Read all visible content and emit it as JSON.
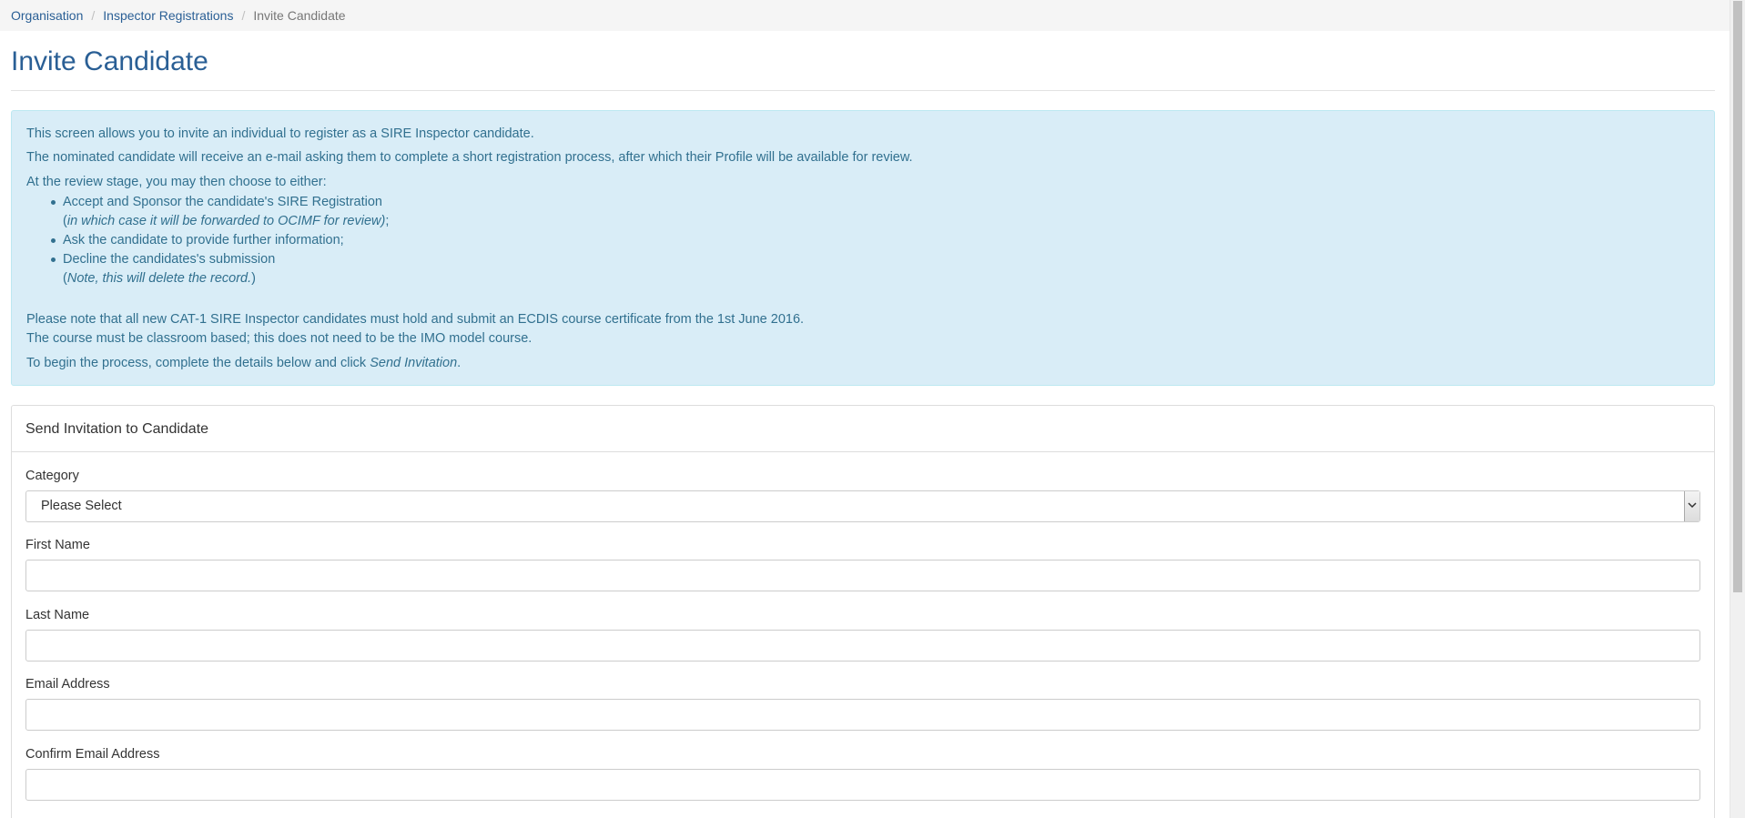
{
  "breadcrumb": {
    "items": [
      "Organisation",
      "Inspector Registrations"
    ],
    "separator": "/",
    "current": "Invite Candidate"
  },
  "page_title": "Invite Candidate",
  "info": {
    "line1": "This screen allows you to invite an individual to register as a SIRE Inspector candidate.",
    "line2": "The nominated candidate will receive an e-mail asking them to complete a short registration process, after which their Profile will be available for review.",
    "line3": "At the review stage, you may then choose to either:",
    "bullets": [
      {
        "text": "Accept and Sponsor the candidate's SIRE Registration",
        "note_open": "(",
        "note_italic": "in which case it will be forwarded to OCIMF for review)",
        "note_close": ";"
      },
      {
        "text": "Ask the candidate to provide further information;"
      },
      {
        "text": "Decline the candidates's submission",
        "note_open": "(",
        "note_italic": "Note, this will delete the record.",
        "note_close": ")"
      }
    ],
    "line4": "Please note that all new CAT-1 SIRE Inspector candidates must hold and submit an ECDIS course certificate from the 1st June 2016.",
    "line5": "The course must be classroom based; this does not need to be the IMO model course.",
    "line6_prefix": "To begin the process, complete the details below and click ",
    "line6_action": "Send Invitation",
    "line6_suffix": "."
  },
  "form": {
    "heading": "Send Invitation to Candidate",
    "category_label": "Category",
    "category_selected": "Please Select",
    "first_name_label": "First Name",
    "first_name_value": "",
    "last_name_label": "Last Name",
    "last_name_value": "",
    "email_label": "Email Address",
    "email_value": "",
    "confirm_email_label": "Confirm Email Address",
    "confirm_email_value": ""
  },
  "colors": {
    "link": "#2a5f95",
    "info_background": "#d9edf7",
    "info_text": "#31708f"
  }
}
